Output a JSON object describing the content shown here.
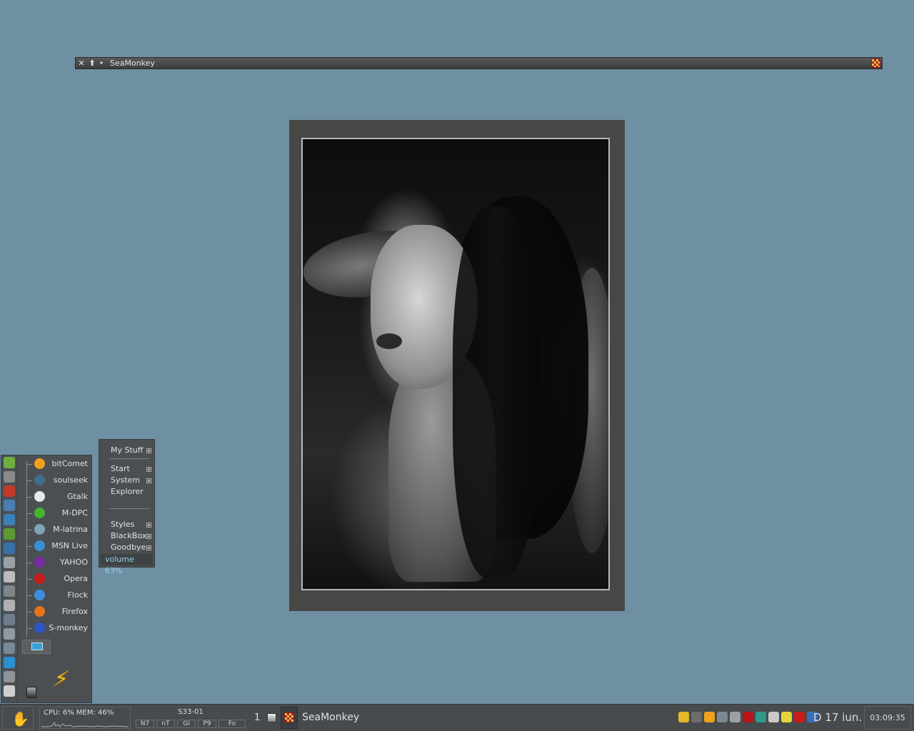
{
  "titlebar": {
    "close_glyph": "✕",
    "raise_glyph": "⬆",
    "dot_glyph": "•",
    "title": "SeaMonkey",
    "app_icon": "seamonkey-icon"
  },
  "dock": {
    "side_icons": [
      "settings-icon",
      "network-icon",
      "pdf-icon",
      "browser-icon",
      "globe-icon",
      "game-icon",
      "wave-icon",
      "display-icon",
      "copy-icon",
      "files-icon",
      "archive-icon",
      "cleanup-icon",
      "image-icon",
      "tools-icon",
      "skype-icon",
      "scissors-icon",
      "terminal-icon"
    ],
    "apps": [
      {
        "label": "bitComet",
        "icon": "bitcomet-icon",
        "color": "#f0a11c"
      },
      {
        "label": "soulseek",
        "icon": "soulseek-icon",
        "color": "#3f6d8e"
      },
      {
        "label": "Gtalk",
        "icon": "gtalk-icon",
        "color": "#e9e9e9"
      },
      {
        "label": "M-DPC",
        "icon": "mdpc-icon",
        "color": "#45b42c"
      },
      {
        "label": "M-latrina",
        "icon": "mlatrina-icon",
        "color": "#7fa3b7"
      },
      {
        "label": "MSN Live",
        "icon": "msn-icon",
        "color": "#3a8fd2"
      },
      {
        "label": "YAHOO",
        "icon": "yahoo-icon",
        "color": "#7b2ba3"
      },
      {
        "label": "Opera",
        "icon": "opera-icon",
        "color": "#c91b1b"
      },
      {
        "label": "Flock",
        "icon": "flock-icon",
        "color": "#3b8fe0"
      },
      {
        "label": "Firefox",
        "icon": "firefox-icon",
        "color": "#e7731b"
      },
      {
        "label": "S-monkey",
        "icon": "seamonkey-icon",
        "color": "#2a56c8"
      }
    ]
  },
  "menu": {
    "items": [
      {
        "label": "My Stuff",
        "sub": true
      },
      {
        "label": "Start",
        "sub": true
      },
      {
        "label": "System",
        "sub": true
      },
      {
        "label": "Explorer",
        "sub": false
      },
      {
        "label": "Styles",
        "sub": true
      },
      {
        "label": "BlackBox",
        "sub": true
      },
      {
        "label": "Goodbye",
        "sub": true
      }
    ],
    "volume": "volume 63%"
  },
  "taskbar": {
    "sysmon": "CPU: 6%   MEM: 46%",
    "desktop_name": "S33-01",
    "desktop_buttons": [
      "N7",
      "nT",
      "Gi",
      "P9",
      "Fo"
    ],
    "workspace": "1",
    "task_title": "SeaMonkey",
    "date": "D 17 iun.",
    "clock": "03:09:35"
  }
}
